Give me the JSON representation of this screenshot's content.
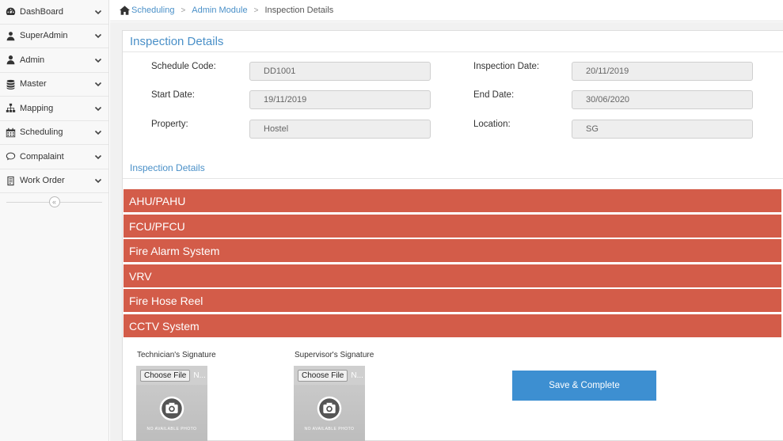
{
  "sidebar": {
    "items": [
      {
        "label": "DashBoard",
        "icon": "dashboard-icon"
      },
      {
        "label": "SuperAdmin",
        "icon": "superadmin-user-icon"
      },
      {
        "label": "Admin",
        "icon": "admin-user-icon"
      },
      {
        "label": "Master",
        "icon": "database-icon"
      },
      {
        "label": "Mapping",
        "icon": "sitemap-icon"
      },
      {
        "label": "Scheduling",
        "icon": "calendar-icon"
      },
      {
        "label": "Compalaint",
        "icon": "chat-icon"
      },
      {
        "label": "Work Order",
        "icon": "document-icon"
      }
    ],
    "collapse_glyph": "«"
  },
  "breadcrumb": {
    "items": [
      "Scheduling",
      "Admin Module"
    ],
    "current": "Inspection Details",
    "separator": ">"
  },
  "panel": {
    "title": "Inspection Details",
    "fields": {
      "schedule_code": {
        "label": "Schedule Code:",
        "value": "DD1001"
      },
      "inspection_date": {
        "label": "Inspection Date:",
        "value": "20/11/2019"
      },
      "start_date": {
        "label": "Start Date:",
        "value": "19/11/2019"
      },
      "end_date": {
        "label": "End Date:",
        "value": "30/06/2020"
      },
      "property": {
        "label": "Property:",
        "value": "Hostel"
      },
      "location": {
        "label": "Location:",
        "value": "SG"
      }
    },
    "section_title": "Inspection Details",
    "accordion": [
      "AHU/PAHU",
      "FCU/PFCU",
      "Fire Alarm System",
      "VRV",
      "Fire Hose Reel",
      "CCTV System"
    ],
    "signatures": {
      "technician": {
        "label": "Technician's Signature",
        "choose_label": "Choose File",
        "file_status": "N...",
        "no_photo": "NO AVAILABLE PHOTO"
      },
      "supervisor": {
        "label": "Supervisor's Signature",
        "choose_label": "Choose File",
        "file_status": "N...",
        "no_photo": "NO AVAILABLE PHOTO"
      }
    },
    "save_label": "Save & Complete"
  },
  "colors": {
    "accent": "#4a90c8",
    "accordion_bg": "#d35c49",
    "save_button": "#3d8fd1"
  }
}
